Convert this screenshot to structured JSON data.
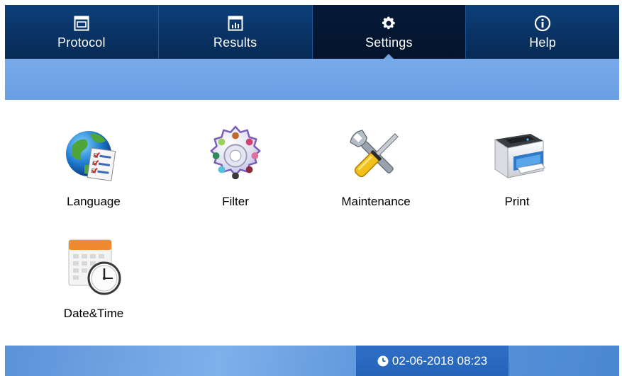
{
  "tabs": [
    {
      "label": "Protocol",
      "icon": "protocol-icon"
    },
    {
      "label": "Results",
      "icon": "results-icon"
    },
    {
      "label": "Settings",
      "icon": "gear-icon",
      "active": true
    },
    {
      "label": "Help",
      "icon": "info-icon"
    }
  ],
  "settings_items": [
    {
      "label": "Language",
      "icon": "globe-checklist-icon"
    },
    {
      "label": "Filter",
      "icon": "filter-wheel-icon"
    },
    {
      "label": "Maintenance",
      "icon": "wrench-screwdriver-icon"
    },
    {
      "label": "Print",
      "icon": "printer-icon"
    },
    {
      "label": "Date&Time",
      "icon": "calendar-clock-icon"
    }
  ],
  "status": {
    "datetime": "02-06-2018 08:23",
    "icon": "clock-icon"
  },
  "colors": {
    "tabbar": "#0a3568",
    "tab_active": "#04142c",
    "subbar": "#6a9fe4",
    "footer": "#5d97dc",
    "clock_bg": "#2363b8"
  }
}
